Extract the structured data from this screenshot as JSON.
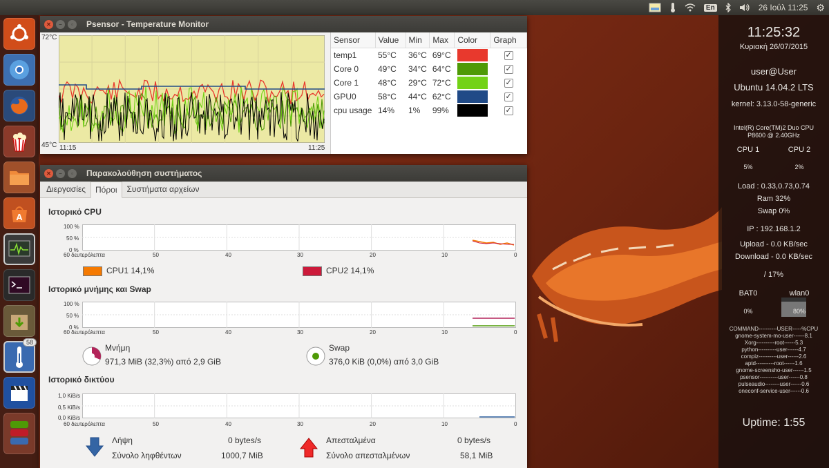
{
  "top_panel": {
    "keyboard": "En",
    "datetime": "26 Ιούλ 11:25"
  },
  "launcher": {
    "badge": "58"
  },
  "psensor": {
    "title": "Psensor - Temperature Monitor",
    "graph": {
      "y_max": "72°C",
      "y_min": "45°C",
      "x_start": "11:15",
      "x_end": "11:25"
    },
    "columns": [
      "Sensor",
      "Value",
      "Min",
      "Max",
      "Color",
      "Graph"
    ],
    "sensors": [
      {
        "name": "temp1",
        "value": "55°C",
        "min": "36°C",
        "max": "69°C",
        "color": "#e8392d"
      },
      {
        "name": "Core 0",
        "value": "49°C",
        "min": "34°C",
        "max": "64°C",
        "color": "#4e9a06"
      },
      {
        "name": "Core 1",
        "value": "48°C",
        "min": "29°C",
        "max": "72°C",
        "color": "#73d216"
      },
      {
        "name": "GPU0",
        "value": "58°C",
        "min": "44°C",
        "max": "62°C",
        "color": "#204a87"
      },
      {
        "name": "cpu usage",
        "value": "14%",
        "min": "1%",
        "max": "99%",
        "color": "#000000"
      }
    ]
  },
  "sysmon": {
    "title": "Παρακολούθηση συστήματος",
    "tabs": [
      "Διεργασίες",
      "Πόροι",
      "Συστήματα αρχείων"
    ],
    "cpu": {
      "title": "Ιστορικό CPU",
      "y_labels": [
        "100 %",
        "50 %",
        "0 %"
      ],
      "x_labels": [
        "60 δευτερόλεπτα",
        "50",
        "40",
        "30",
        "20",
        "10",
        "0"
      ],
      "cpu1_label": "CPU1  14,1%",
      "cpu2_label": "CPU2  14,1%",
      "cpu1_color": "#f57900",
      "cpu2_color": "#cc1a3a"
    },
    "memory": {
      "title": "Ιστορικό μνήμης και Swap",
      "y_labels": [
        "100 %",
        "50 %",
        "0 %"
      ],
      "x_labels": [
        "60 δευτερόλεπτα",
        "50",
        "40",
        "30",
        "20",
        "10",
        "0"
      ],
      "mem_label": "Μνήμη",
      "mem_value": "971,3 MiB (32,3%) από 2,9 GiB",
      "swap_label": "Swap",
      "swap_value": "376,0 KiB (0,0%) από 3,0 GiB"
    },
    "network": {
      "title": "Ιστορικό δικτύου",
      "y_labels": [
        "1,0 KiB/s",
        "0,5 KiB/s",
        "0,0 KiB/s"
      ],
      "x_labels": [
        "60 δευτερόλεπτα",
        "50",
        "40",
        "30",
        "20",
        "10",
        "0"
      ],
      "rx_label": "Λήψη",
      "rx_rate": "0 bytes/s",
      "rx_total_label": "Σύνολο ληφθέντων",
      "rx_total": "1000,7 MiB",
      "tx_label": "Απεσταλμένα",
      "tx_rate": "0 bytes/s",
      "tx_total_label": "Σύνολο απεσταλμένων",
      "tx_total": "58,1 MiB"
    }
  },
  "conky": {
    "time": "11:25:32",
    "date": "Κυριακή 26/07/2015",
    "user": "user@User",
    "os": "Ubuntu 14.04.2 LTS",
    "kernel": "kernel: 3.13.0-58-generic",
    "cpu_model_1": "Intel(R) Core(TM)2 Duo CPU",
    "cpu_model_2": "P8600  @ 2.40GHz",
    "cpu1_label": "CPU 1",
    "cpu2_label": "CPU 2",
    "cpu1_value": "5%",
    "cpu2_value": "2%",
    "load": "Load : 0.33,0.73,0.74",
    "ram": "Ram 32%",
    "swap": "Swap 0%",
    "ip": "IP : 192.168.1.2",
    "upload": "Upload - 0.0 KB/sec",
    "download": "Download - 0.0 KB/sec",
    "disk": "/ 17%",
    "bat_label": "BAT0",
    "wlan_label": "wlan0",
    "bat_value": "0%",
    "wlan_value": "80%",
    "wlan_level": 0.8,
    "processes": [
      "COMMAND----------USER-----%CPU",
      "gnome-system-mo-user------8.1",
      "Xorg----------root------5.3",
      "python----------user------4.7",
      "compiz----------user------2.6",
      "aptd----------root------1.6",
      "gnome-screensho-user------1.5",
      "psensor----------user------0.8",
      "pulseaudio--------user------0.6",
      "oneconf-service-user------0.6"
    ],
    "uptime": "Uptime: 1:55"
  }
}
